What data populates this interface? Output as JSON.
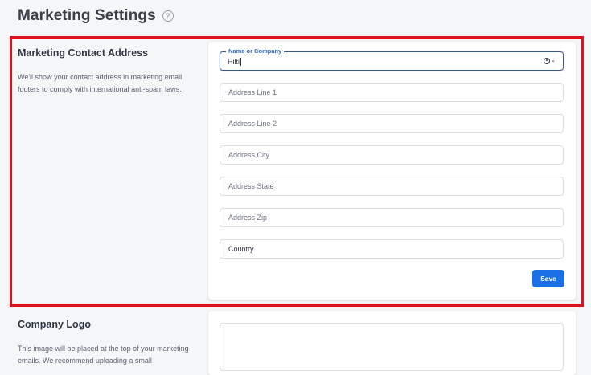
{
  "page": {
    "title": "Marketing Settings"
  },
  "contact_section": {
    "title": "Marketing Contact Address",
    "description": "We'll show your contact address in marketing email footers to comply with international anti-spam laws.",
    "name_field": {
      "label": "Name or Company",
      "value": "Hilti"
    },
    "fields": [
      {
        "placeholder": "Address Line 1"
      },
      {
        "placeholder": "Address Line 2"
      },
      {
        "placeholder": "Address City"
      },
      {
        "placeholder": "Address State"
      },
      {
        "placeholder": "Address Zip"
      }
    ],
    "country": {
      "value": "Country"
    },
    "save_label": "Save"
  },
  "logo_section": {
    "title": "Company Logo",
    "description": "This image will be placed at the top of your marketing emails. We recommend uploading a small"
  },
  "colors": {
    "accent": "#1a6ee6",
    "highlight": "#e0131c",
    "focus_label": "#2f66c7"
  }
}
